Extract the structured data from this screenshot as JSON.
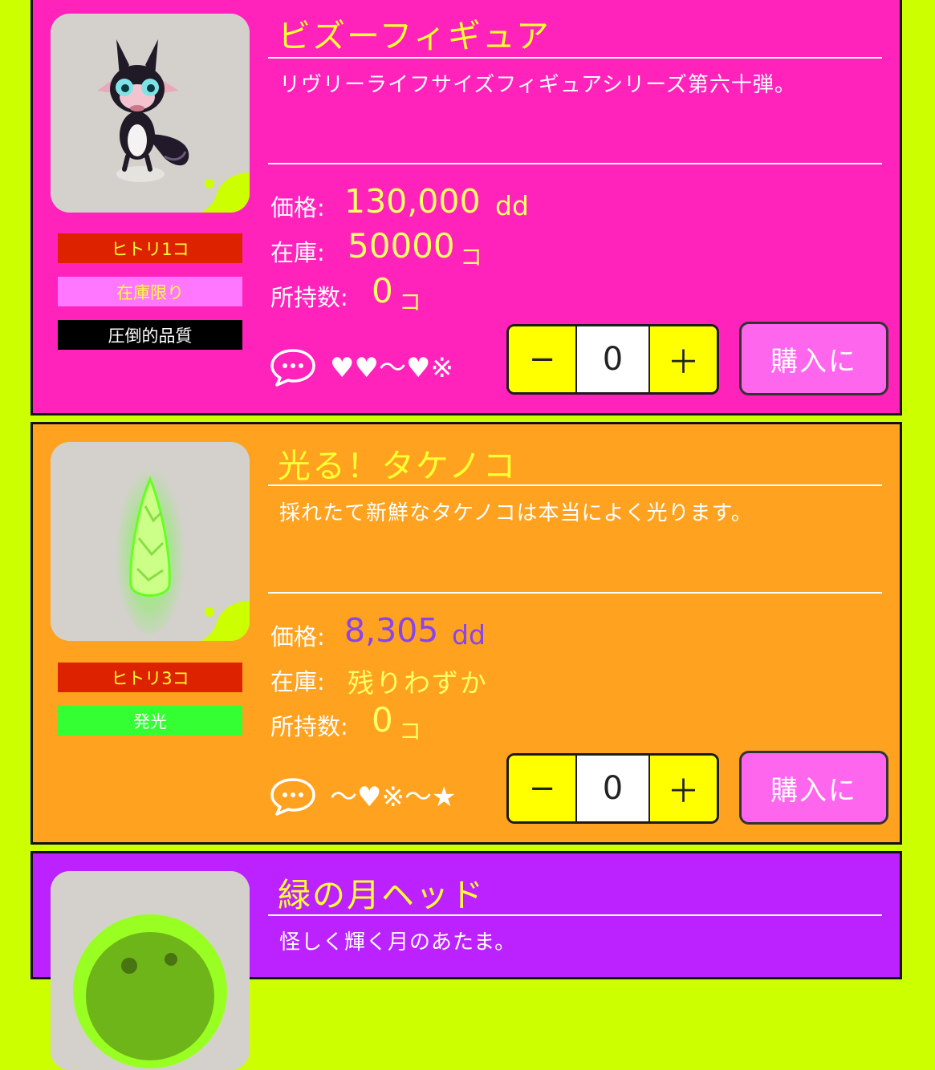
{
  "products": [
    {
      "title": "ビズーフィギュア",
      "description": "リヴリーライフサイズフィギュアシリーズ第六十弾。",
      "badges": [
        {
          "label": "ヒトリ1コ",
          "bg": "#dd2200",
          "color": "#ffff33"
        },
        {
          "label": "在庫限り",
          "bg": "#ff77ff",
          "color": "#ffff33"
        },
        {
          "label": "圧倒的品質",
          "bg": "#000000",
          "color": "#ffffff"
        }
      ],
      "price_label": "価格:",
      "price_value": "130,000",
      "price_unit": "dd",
      "price_color": "#ffff66",
      "stock_label": "在庫:",
      "stock_value": "50000",
      "stock_unit": "コ",
      "owned_label": "所持数:",
      "owned_value": "0",
      "owned_unit": "コ",
      "reaction": "♥♥〜♥※",
      "quantity": "0",
      "minus_label": "−",
      "plus_label": "＋",
      "buy_label": "購入に"
    },
    {
      "title": "光る！タケノコ",
      "description": "採れたて新鮮なタケノコは本当によく光ります。",
      "badges": [
        {
          "label": "ヒトリ3コ",
          "bg": "#dd2200",
          "color": "#ffff33"
        },
        {
          "label": "発光",
          "bg": "#33ff33",
          "color": "#ffffff"
        }
      ],
      "price_label": "価格:",
      "price_value": "8,305",
      "price_unit": "dd",
      "price_color": "#8844ee",
      "stock_label": "在庫:",
      "stock_value": "残りわずか",
      "stock_unit": "",
      "owned_label": "所持数:",
      "owned_value": "0",
      "owned_unit": "コ",
      "reaction": "〜♥※〜★",
      "quantity": "0",
      "minus_label": "−",
      "plus_label": "＋",
      "buy_label": "購入に"
    },
    {
      "title": "緑の月ヘッド",
      "description": "怪しく輝く月のあたま。"
    }
  ]
}
